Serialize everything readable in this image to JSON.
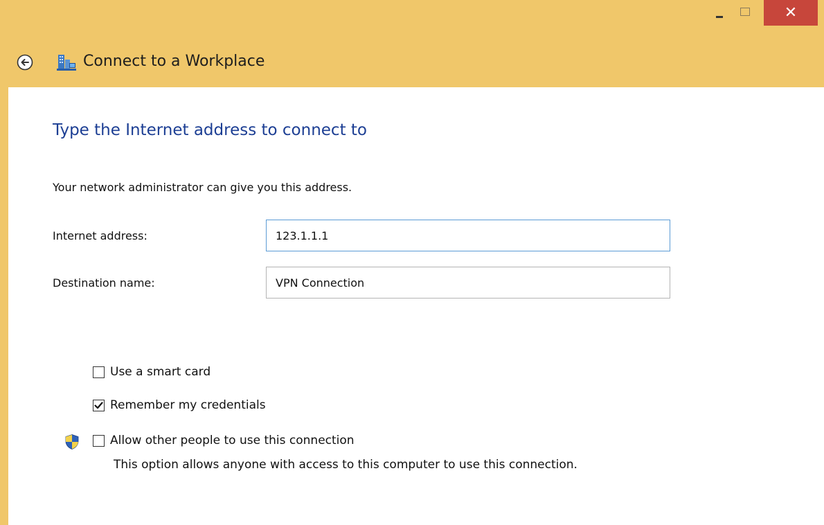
{
  "window": {
    "title": "Connect to a Workplace",
    "controls": {
      "minimize_icon": "minimize-icon",
      "maximize_icon": "maximize-icon",
      "close_icon": "close-icon",
      "close_glyph": "✕"
    }
  },
  "colors": {
    "frame": "#f0c76a",
    "close_button": "#c7463b",
    "heading": "#1d3f94",
    "focused_border": "#5b9bd5"
  },
  "page": {
    "heading": "Type the Internet address to connect to",
    "intro": "Your network administrator can give you this address.",
    "fields": {
      "internet_address": {
        "label": "Internet address:",
        "value": "123.1.1.1"
      },
      "destination_name": {
        "label": "Destination name:",
        "value": "VPN Connection"
      }
    },
    "options": {
      "smart_card": {
        "label": "Use a smart card",
        "checked": false
      },
      "remember_credentials": {
        "label": "Remember my credentials",
        "checked": true
      },
      "allow_others": {
        "label": "Allow other people to use this connection",
        "checked": false,
        "note": "This option allows anyone with access to this computer to use this connection."
      }
    }
  }
}
